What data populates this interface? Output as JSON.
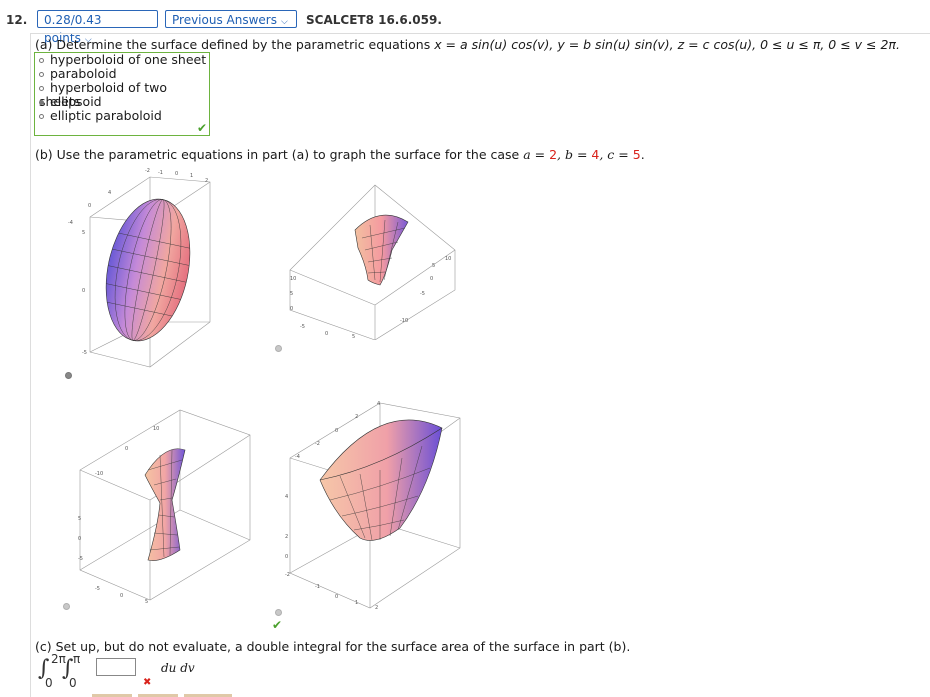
{
  "question": {
    "number": "12.",
    "points_label": "0.28/0.43 points",
    "previous_answers_label": "Previous Answers",
    "code": "SCALCET8 16.6.059."
  },
  "part_a": {
    "prompt_prefix": "(a) Determine the surface defined by the parametric equations ",
    "equation": "x = a sin(u) cos(v), y = b sin(u) sin(v), z = c cos(u), 0 ≤ u ≤ π, 0 ≤ v ≤ 2π.",
    "choices": [
      {
        "label": "hyperboloid of one sheet",
        "selected": false
      },
      {
        "label": "paraboloid",
        "selected": false
      },
      {
        "label": "hyperboloid of two sheets",
        "selected": false
      },
      {
        "label": "ellipsoid",
        "selected": true
      },
      {
        "label": "elliptic paraboloid",
        "selected": false
      }
    ],
    "status_icon": "check-icon",
    "status_symbol": "✔"
  },
  "part_b": {
    "prompt_prefix": "(b) Use the parametric equations in part (a) to graph the surface for the case ",
    "a_label": "a = ",
    "a_value": "2",
    "b_label": ", b = ",
    "b_value": "4",
    "c_label": ", c = ",
    "c_value": "5",
    "suffix": ".",
    "graphs": [
      {
        "name": "ellipsoid-graph",
        "selected": true,
        "ticks": [
          "-2",
          "-1",
          "0",
          "1",
          "2",
          "-4",
          "0",
          "4",
          "-5",
          "0",
          "5"
        ]
      },
      {
        "name": "hyperboloid-graph",
        "selected": false,
        "ticks": [
          "10",
          "5",
          "0",
          "-10",
          "-5",
          "0",
          "5",
          "-5",
          "0",
          "5",
          "10"
        ]
      },
      {
        "name": "hourglass-graph",
        "selected": false,
        "ticks": [
          "10",
          "0",
          "-10",
          "5",
          "0",
          "-5",
          "-5",
          "0",
          "5"
        ]
      },
      {
        "name": "paraboloid-graph",
        "selected": false,
        "ticks": [
          "4",
          "2",
          "0",
          "-2",
          "-4",
          "4",
          "2",
          "0",
          "-2",
          "-1",
          "0",
          "1",
          "2"
        ]
      }
    ],
    "status_icon": "check-icon",
    "status_symbol": "✔"
  },
  "part_c": {
    "prompt": "(c) Set up, but do not evaluate, a double integral for the surface area of the surface in part (b).",
    "outer_upper": "2π",
    "outer_lower": "0",
    "inner_upper": "π",
    "inner_lower": "0",
    "integral_symbol": "∫",
    "input_value": "",
    "differential": "du dv",
    "status_icon": "cross-icon",
    "status_symbol": "✖"
  },
  "colors": {
    "accent": "#2a66b8",
    "correct": "#4aa02c",
    "incorrect": "#d9231c",
    "choice_border": "#6db33f"
  }
}
